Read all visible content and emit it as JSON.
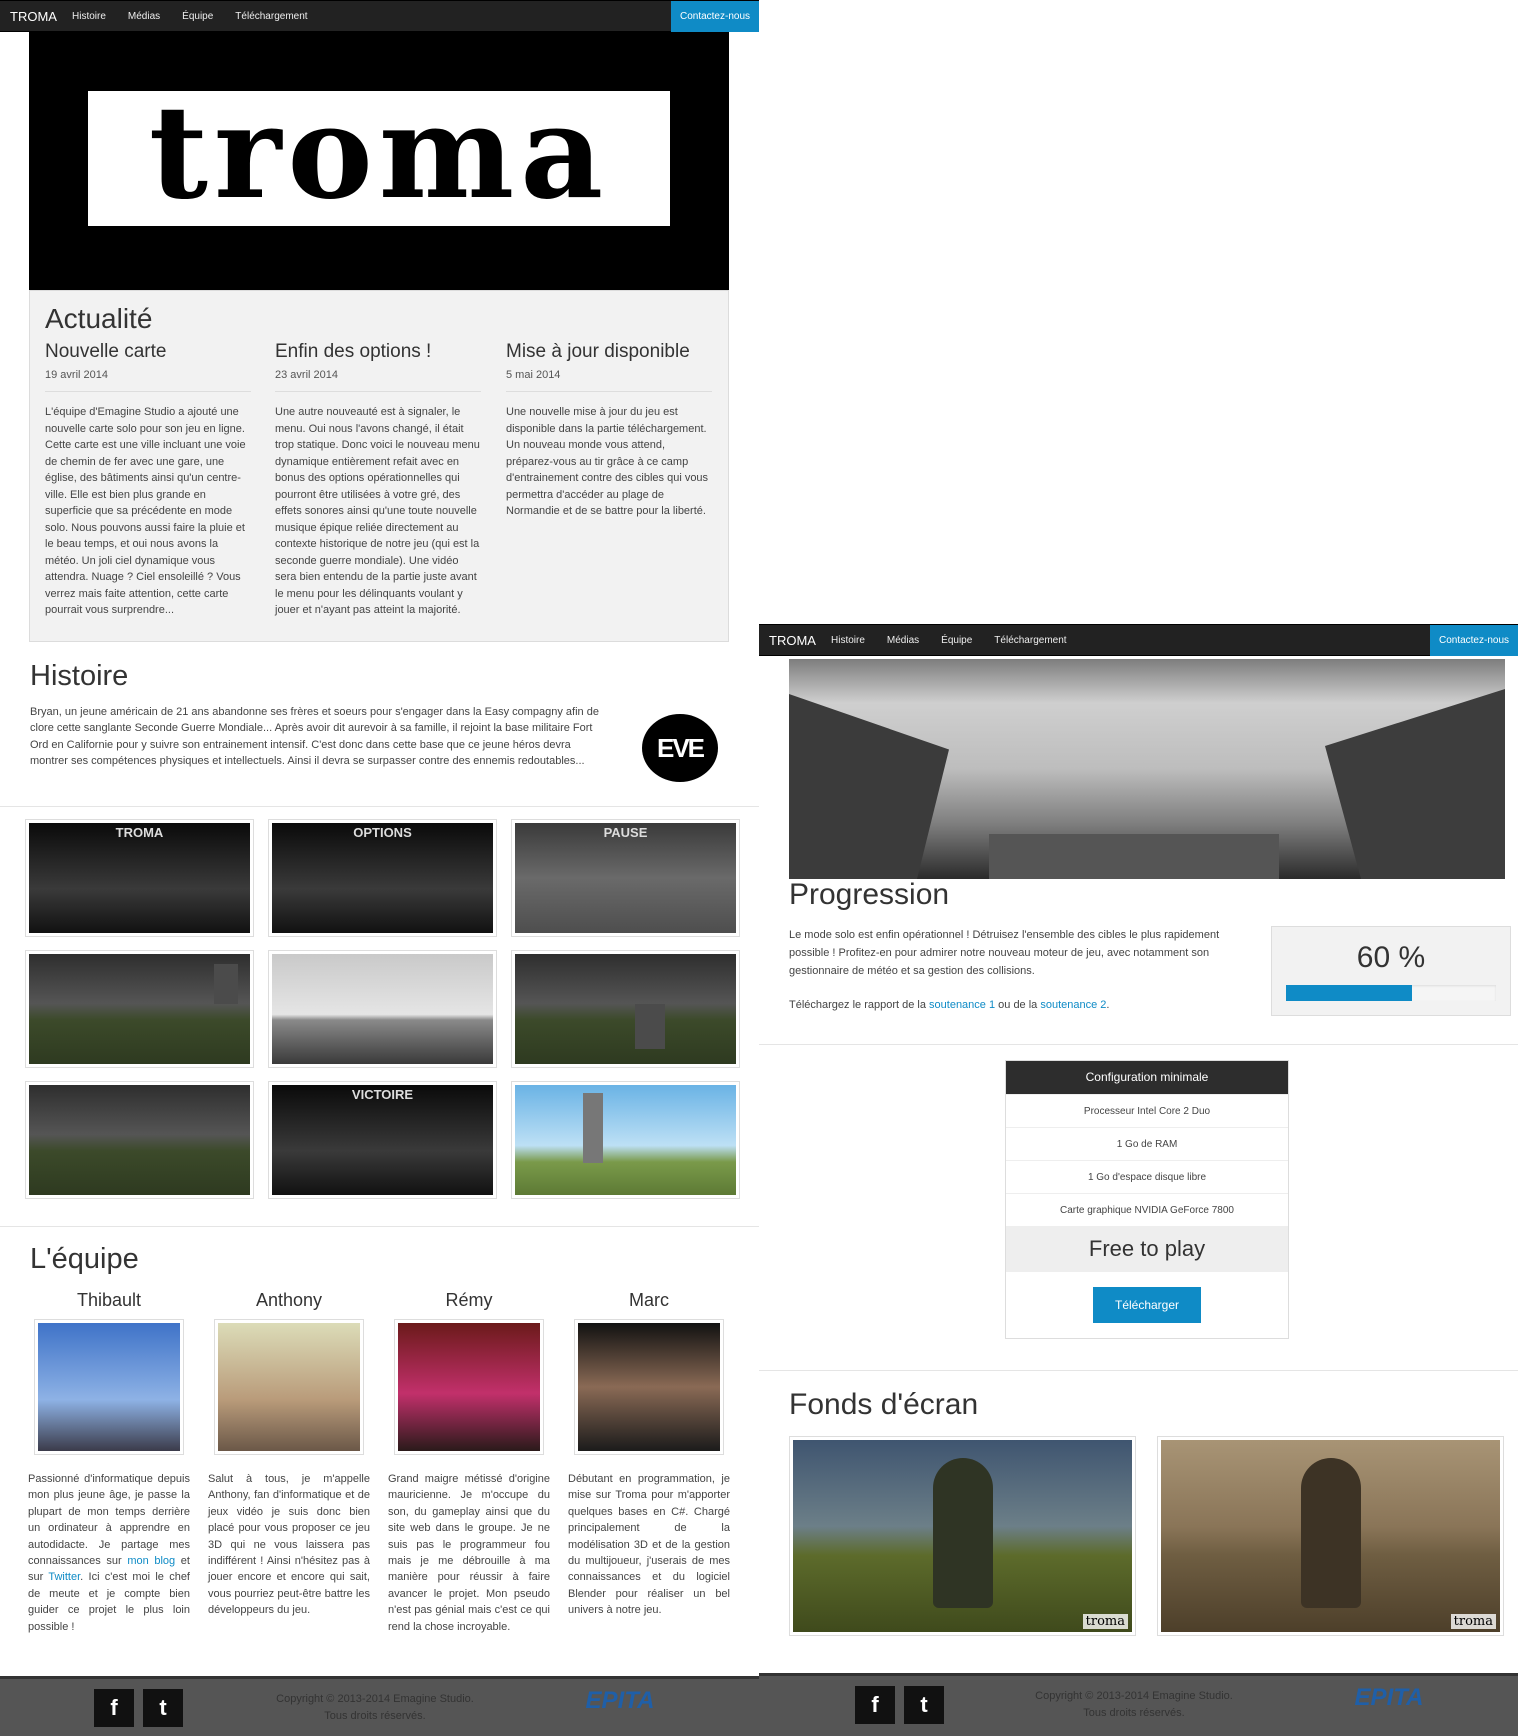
{
  "nav": {
    "brand": "TROMA",
    "items": [
      "Histoire",
      "Médias",
      "Équipe",
      "Téléchargement"
    ],
    "contact": "Contactez-nous"
  },
  "hero": {
    "logo_text": "troma"
  },
  "news": {
    "title": "Actualité",
    "items": [
      {
        "title": "Nouvelle carte",
        "date": "19 avril 2014",
        "text": "L'équipe d'Emagine Studio a ajouté une nouvelle carte solo pour son jeu en ligne. Cette carte est une ville incluant une voie de chemin de fer avec une gare, une église, des bâtiments ainsi qu'un centre-ville. Elle est bien plus grande en superficie que sa précédente en mode solo. Nous pouvons aussi faire la pluie et le beau temps, et oui nous avons la météo. Un joli ciel dynamique vous attendra. Nuage ? Ciel ensoleillé ? Vous verrez mais faite attention, cette carte pourrait vous surprendre..."
      },
      {
        "title": "Enfin des options !",
        "date": "23 avril 2014",
        "text": "Une autre nouveauté est à signaler, le menu. Oui nous l'avons changé, il était trop statique. Donc voici le nouveau menu dynamique entièrement refait avec en bonus des options opérationnelles qui pourront être utilisées à votre gré, des effets sonores ainsi qu'une toute nouvelle musique épique reliée directement au contexte historique de notre jeu (qui est la seconde guerre mondiale). Une vidéo sera bien entendu de la partie juste avant le menu pour les délinquants voulant y jouer et n'ayant pas atteint la majorité."
      },
      {
        "title": "Mise à jour disponible",
        "date": "5 mai 2014",
        "text": "Une nouvelle mise à jour du jeu est disponible dans la partie téléchargement. Un nouveau monde vous attend, préparez-vous au tir grâce à ce camp d'entrainement contre des cibles qui vous permettra d'accéder au plage de Normandie et de se battre pour la liberté."
      }
    ]
  },
  "histoire": {
    "title": "Histoire",
    "text": "Bryan, un jeune américain de 21 ans abandonne ses frères et soeurs pour s'engager dans la Easy compagny afin de clore cette sanglante Seconde Guerre Mondiale... Après avoir dit aurevoir à sa famille, il rejoint la base militaire Fort Ord en Californie pour y suivre son entrainement intensif. C'est donc dans cette base que ce jeune héros devra montrer ses compétences physiques et intellectuels. Ainsi il devra se surpasser contre des ennemis redoutables...",
    "logo_text": "EVE"
  },
  "gallery": {
    "labels": [
      "TROMA",
      "OPTIONS",
      "PAUSE",
      "",
      "",
      "",
      "",
      "VICTOIRE",
      ""
    ]
  },
  "equipe": {
    "title": "L'équipe",
    "members": [
      {
        "name": "Thibault",
        "text_before": "Passionné d'informatique depuis mon plus jeune âge, je passe la plupart de mon temps derrière un ordinateur à apprendre en autodidacte. Je partage mes connaissances sur ",
        "link1": "mon blog",
        "text_mid": " et sur ",
        "link2": "Twitter",
        "text_after": ". Ici c'est moi le chef de meute et je compte bien guider ce projet le plus loin possible !"
      },
      {
        "name": "Anthony",
        "text": "Salut à tous, je m'appelle Anthony, fan d'informatique et de jeux vidéo je suis donc bien placé pour vous proposer ce jeu 3D qui ne vous laissera pas indifférent ! Ainsi n'hésitez pas à jouer encore et encore qui sait, vous pourriez peut-être battre les développeurs du jeu."
      },
      {
        "name": "Rémy",
        "text": "Grand maigre métissé d'origine mauricienne. Je m'occupe du son, du gameplay ainsi que du site web dans le groupe. Je ne suis pas le programmeur fou mais je me débrouille à ma manière pour réussir à faire avancer le projet. Mon pseudo n'est pas génial mais c'est ce qui rend la chose incroyable."
      },
      {
        "name": "Marc",
        "text": "Débutant en programmation, je mise sur Troma pour m'apporter quelques bases en C#. Chargé principalement de la modélisation 3D et de la gestion du multijoueur, j'userais de mes connaissances et du logiciel Blender pour réaliser un bel univers à notre jeu."
      }
    ]
  },
  "footer": {
    "facebook": "f",
    "twitter": "t",
    "copyright": "Copyright © 2013-2014 Emagine Studio.",
    "rights": "Tous droits réservés.",
    "school": "EPITA"
  },
  "progression": {
    "title": "Progression",
    "text": "Le mode solo est enfin opérationnel ! Détruisez l'ensemble des cibles le plus rapidement possible ! Profitez-en pour admirer notre nouveau moteur de jeu, avec notamment son gestionnaire de météo et sa gestion des collisions.",
    "report_before": "Téléchargez le rapport de la ",
    "report_link1": "soutenance 1",
    "report_mid": " ou de la ",
    "report_link2": "soutenance 2",
    "report_after": ".",
    "percent_label": "60 %",
    "percent_value": 60
  },
  "config": {
    "title": "Configuration minimale",
    "rows": [
      "Processeur Intel Core 2 Duo",
      "1 Go de RAM",
      "1 Go d'espace disque libre",
      "Carte graphique NVIDIA GeForce 7800"
    ],
    "price": "Free to play",
    "button": "Télécharger"
  },
  "wallpapers": {
    "title": "Fonds d'écran",
    "tag": "troma"
  },
  "colors": {
    "accent": "#0f8bc6",
    "navbar": "#222222",
    "footer": "#555555"
  }
}
